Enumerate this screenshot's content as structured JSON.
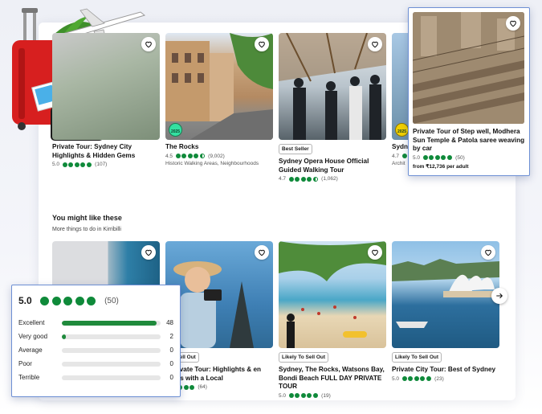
{
  "top_cards": [
    {
      "title": "Private Tour: Sydney City Highlights & Hidden Gems",
      "rating": "5.0",
      "reviews": "(107)"
    },
    {
      "title": "The Rocks",
      "rating": "4.5",
      "reviews": "(9,002)",
      "award": "2025",
      "subtitle": "Historic Walking Areas, Neighbourhoods"
    },
    {
      "badge": "Best Seller",
      "title": "Sydney Opera House Official Guided Walking Tour",
      "rating": "4.7",
      "reviews": "(1,062)"
    },
    {
      "title": "Sydn",
      "rating": "4.7",
      "award": "2025",
      "subtitle": "Archit"
    }
  ],
  "popup_card": {
    "title": "Private Tour of Step well, Modhera Sun Temple & Patola saree weaving by car",
    "rating": "5.0",
    "reviews": "(50)",
    "price": "from ₹12,736 per adult"
  },
  "section": {
    "title": "You might like these",
    "subtitle": "More things to do in Kirribilli"
  },
  "bottom_cards": [
    {
      "badge": "",
      "title": "",
      "reviews": ""
    },
    {
      "badge": "To Sell Out",
      "title": "y Private Tour: Highlights & en Gems with a Local",
      "reviews": "(64)"
    },
    {
      "badge": "Likely To Sell Out",
      "title": "Sydney, The Rocks, Watsons Bay, Bondi Beach FULL DAY PRIVATE TOUR",
      "rating": "5.0",
      "reviews": "(19)"
    },
    {
      "badge": "Likely To Sell Out",
      "title": "Private City Tour: Best of Sydney",
      "rating": "5.0",
      "reviews": "(23)"
    }
  ],
  "review_summary": {
    "score": "5.0",
    "count": "(50)",
    "rows": [
      {
        "label": "Excellent",
        "count": "48",
        "fraction": 0.96
      },
      {
        "label": "Very good",
        "count": "2",
        "fraction": 0.04
      },
      {
        "label": "Average",
        "count": "0",
        "fraction": 0
      },
      {
        "label": "Poor",
        "count": "0",
        "fraction": 0
      },
      {
        "label": "Terrible",
        "count": "0",
        "fraction": 0
      }
    ]
  },
  "colors": {
    "rating_green": "#0f8a3a",
    "bar_green": "#1f8a3c",
    "highlight_border": "#6d8fd4"
  },
  "icons": [
    "heart-icon",
    "chevron-right-icon",
    "suitcase-icon",
    "airplane-icon",
    "camera-icon",
    "globe-icon"
  ]
}
